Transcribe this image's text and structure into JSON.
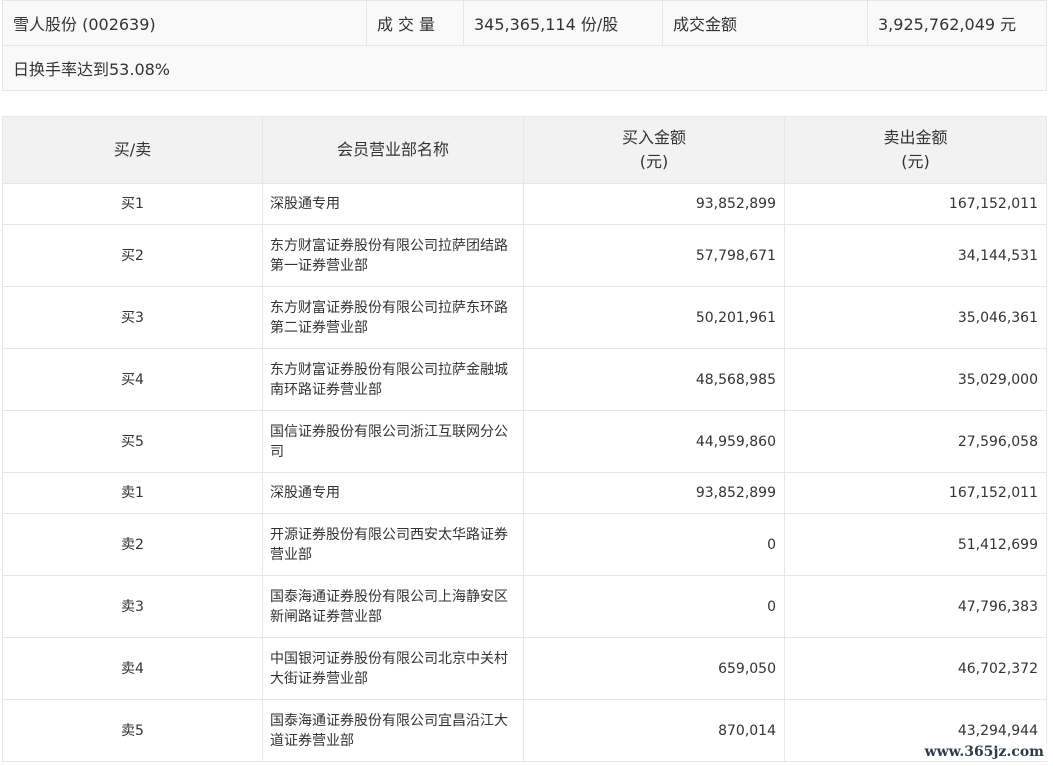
{
  "summary": {
    "stock": "雪人股份 (002639)",
    "volume_label": "成交量",
    "volume_value": "345,365,114 份/股",
    "amount_label": "成交金额",
    "amount_value": "3,925,762,049 元",
    "turnover_note": "日换手率达到53.08%"
  },
  "table": {
    "headers": {
      "side": "买/卖",
      "name": "会员营业部名称",
      "buy_line1": "买入金额",
      "buy_line2": "(元)",
      "sell_line1": "卖出金额",
      "sell_line2": "(元)"
    },
    "rows": [
      {
        "side": "买1",
        "name": "深股通专用",
        "buy": "93,852,899",
        "sell": "167,152,011"
      },
      {
        "side": "买2",
        "name": "东方财富证券股份有限公司拉萨团结路第一证券营业部",
        "buy": "57,798,671",
        "sell": "34,144,531"
      },
      {
        "side": "买3",
        "name": "东方财富证券股份有限公司拉萨东环路第二证券营业部",
        "buy": "50,201,961",
        "sell": "35,046,361"
      },
      {
        "side": "买4",
        "name": "东方财富证券股份有限公司拉萨金融城南环路证券营业部",
        "buy": "48,568,985",
        "sell": "35,029,000"
      },
      {
        "side": "买5",
        "name": "国信证券股份有限公司浙江互联网分公司",
        "buy": "44,959,860",
        "sell": "27,596,058"
      },
      {
        "side": "卖1",
        "name": "深股通专用",
        "buy": "93,852,899",
        "sell": "167,152,011"
      },
      {
        "side": "卖2",
        "name": "开源证券股份有限公司西安太华路证券营业部",
        "buy": "0",
        "sell": "51,412,699"
      },
      {
        "side": "卖3",
        "name": "国泰海通证券股份有限公司上海静安区新闸路证券营业部",
        "buy": "0",
        "sell": "47,796,383"
      },
      {
        "side": "卖4",
        "name": "中国银河证券股份有限公司北京中关村大街证券营业部",
        "buy": "659,050",
        "sell": "46,702,372"
      },
      {
        "side": "卖5",
        "name": "国泰海通证券股份有限公司宜昌沿江大道证券营业部",
        "buy": "870,014",
        "sell": "43,294,944"
      }
    ]
  },
  "watermark": "www.365jz.com"
}
